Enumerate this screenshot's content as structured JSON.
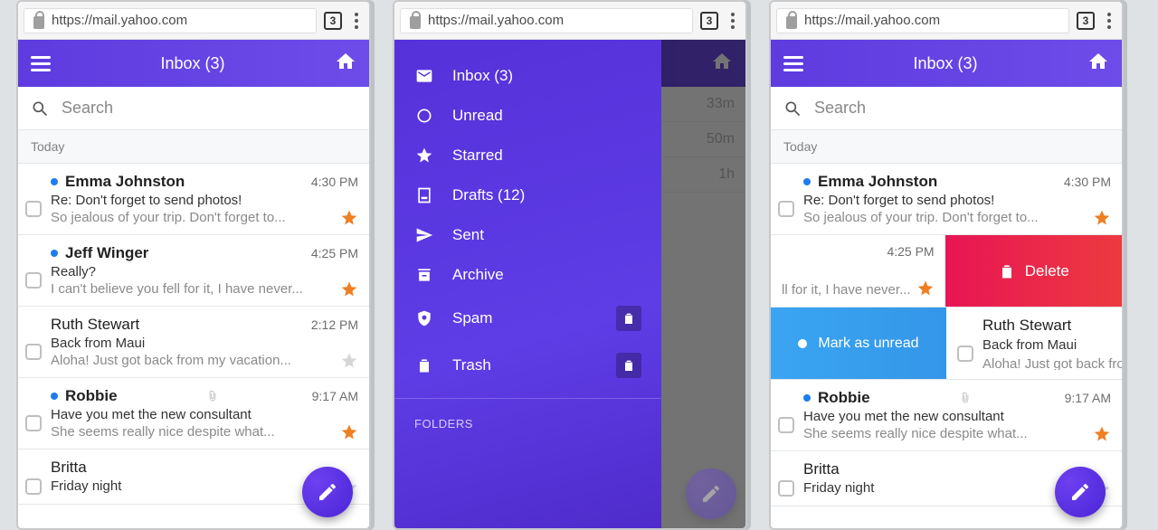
{
  "browser": {
    "url": "https://mail.yahoo.com",
    "tab_count": "3"
  },
  "appbar": {
    "title": "Inbox (3)"
  },
  "search": {
    "placeholder": "Search"
  },
  "section_today": "Today",
  "fab_label": "Compose",
  "emails": [
    {
      "sender": "Emma Johnston",
      "time": "4:30 PM",
      "subject": "Re: Don't forget to send photos!",
      "preview": "So jealous of your trip. Don't forget to...",
      "unread": true,
      "starred": true
    },
    {
      "sender": "Jeff Winger",
      "time": "4:25 PM",
      "subject": "Really?",
      "preview": "I can't believe you fell for it, I have never...",
      "unread": true,
      "starred": true
    },
    {
      "sender": "Ruth Stewart",
      "time": "2:12 PM",
      "subject": "Back from Maui",
      "preview": "Aloha! Just got back from my vacation...",
      "unread": false,
      "starred": false
    },
    {
      "sender": "Robbie",
      "time": "9:17 AM",
      "subject": "Have you met the new consultant",
      "preview": "She seems really nice despite what...",
      "unread": true,
      "starred": true,
      "attachment": true
    },
    {
      "sender": "Britta",
      "time": "",
      "subject": "Friday night",
      "preview": "",
      "unread": false,
      "starred": false
    }
  ],
  "drawer": {
    "items": [
      {
        "label": "Inbox (3)",
        "icon": "mail"
      },
      {
        "label": "Unread",
        "icon": "circle"
      },
      {
        "label": "Starred",
        "icon": "star"
      },
      {
        "label": "Drafts (12)",
        "icon": "draft"
      },
      {
        "label": "Sent",
        "icon": "send"
      },
      {
        "label": "Archive",
        "icon": "archive"
      },
      {
        "label": "Spam",
        "icon": "shield",
        "trash": true
      },
      {
        "label": "Trash",
        "icon": "trash",
        "trash": true
      }
    ],
    "folders_header": "FOLDERS"
  },
  "peek_times": [
    "33m",
    "50m",
    "1h"
  ],
  "swipe": {
    "time_shown": "4:25 PM",
    "preview_shown": "ll for it, I have never...",
    "delete_label": "Delete",
    "mark_unread_label": "Mark as unread",
    "ruth_sender": "Ruth Stewart",
    "ruth_subject": "Back from Maui",
    "ruth_preview": "Aloha! Just got back from my vacation..."
  }
}
